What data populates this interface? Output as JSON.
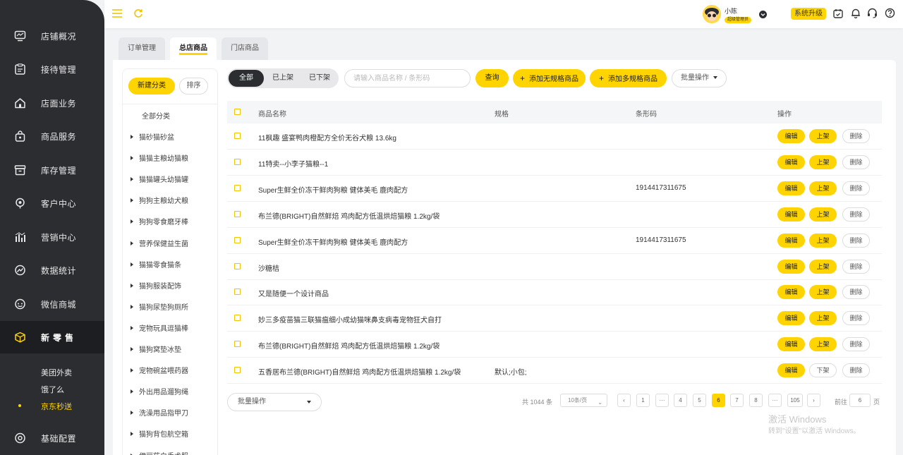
{
  "sidebar": {
    "items": [
      {
        "label": "店铺概况",
        "icon": "monitor-icon"
      },
      {
        "label": "接待管理",
        "icon": "clipboard-icon"
      },
      {
        "label": "店面业务",
        "icon": "home-icon"
      },
      {
        "label": "商品服务",
        "icon": "bag-icon"
      },
      {
        "label": "库存管理",
        "icon": "box-icon"
      },
      {
        "label": "客户中心",
        "icon": "location-icon"
      },
      {
        "label": "营销中心",
        "icon": "chart-bar-icon"
      },
      {
        "label": "数据统计",
        "icon": "trend-icon"
      },
      {
        "label": "微信商城",
        "icon": "wechat-icon"
      },
      {
        "label": "新零售",
        "icon": "cube-icon"
      },
      {
        "label": "基础配置",
        "icon": "settings-icon"
      }
    ],
    "sub_items": [
      "美团外卖",
      "饿了么",
      "京东秒送"
    ]
  },
  "topbar": {
    "user_name": "小陈",
    "user_role": "超级管理员",
    "upgrade_label": "系统升级"
  },
  "tabs": [
    "订单管理",
    "总店商品",
    "门店商品"
  ],
  "category": {
    "new_label": "新建分类",
    "sort_label": "排序",
    "all_label": "全部分类",
    "items": [
      "猫砂猫砂盆",
      "猫猫主粮幼猫粮",
      "猫猫罐头幼猫罐",
      "狗狗主粮幼犬粮",
      "狗狗零食磨牙棒",
      "营养保健益生菌",
      "猫猫零食猫条",
      "猫狗服装配饰",
      "猫狗尿垫狗厕所",
      "宠物玩具逗猫棒",
      "猫狗窝垫冰垫",
      "宠物碗盆喂药器",
      "外出用品遛狗绳",
      "洗澡用品指甲刀",
      "猫狗背包航空箱",
      "伊丽莎白手术服"
    ]
  },
  "filters": {
    "segments": [
      "全部",
      "已上架",
      "已下架"
    ],
    "search_placeholder": "请输入商品名称 / 条形码",
    "query_label": "查询",
    "add_no_spec_label": "添加无规格商品",
    "add_multi_spec_label": "添加多规格商品",
    "batch_label": "批量操作"
  },
  "table": {
    "headers": {
      "name": "商品名称",
      "spec": "规格",
      "barcode": "条形码",
      "ops": "操作"
    },
    "edit_label": "编辑",
    "delete_label": "删除",
    "rows": [
      {
        "name": "11枫趣 盛宴鸭肉橙配方全价无谷犬粮 13.6kg",
        "spec": "",
        "barcode": "",
        "status": "上架"
      },
      {
        "name": "11特卖--小李子猫粮--1",
        "spec": "",
        "barcode": "",
        "status": "上架"
      },
      {
        "name": "Super生鲜全价冻干鲜肉狗粮 健体美毛 鹿肉配方",
        "spec": "",
        "barcode": "1914417311675",
        "status": "上架"
      },
      {
        "name": "布兰德(BRIGHT)自然鲜焙 鸡肉配方低温烘焙猫粮 1.2kg/袋",
        "spec": "",
        "barcode": "",
        "status": "上架"
      },
      {
        "name": "Super生鲜全价冻干鲜肉狗粮 健体美毛 鹿肉配方",
        "spec": "",
        "barcode": "1914417311675",
        "status": "上架"
      },
      {
        "name": "沙糖桔",
        "spec": "",
        "barcode": "",
        "status": "上架"
      },
      {
        "name": "又是随便一个设计商品",
        "spec": "",
        "barcode": "",
        "status": "上架"
      },
      {
        "name": "妙三多疫苗猫三联猫瘟细小成幼猫咪鼻支病毒宠物狂犬自打",
        "spec": "",
        "barcode": "",
        "status": "上架"
      },
      {
        "name": "布兰德(BRIGHT)自然鲜焙 鸡肉配方低温烘焙猫粮 1.2kg/袋",
        "spec": "",
        "barcode": "",
        "status": "上架"
      },
      {
        "name": "五香居布兰德(BRIGHT)自然鲜焙 鸡肉配方低温烘焙猫粮 1.2kg/袋",
        "spec": "默认;小包;",
        "barcode": "",
        "status": "下架"
      }
    ]
  },
  "pagination": {
    "batch_label": "批量操作",
    "total": "共 1044 条",
    "page_size": "10条/页",
    "pages": [
      "1",
      "···",
      "4",
      "5",
      "6",
      "7",
      "8",
      "···",
      "105"
    ],
    "current": "6",
    "goto_prefix": "前往",
    "goto_value": "6",
    "goto_suffix": "页"
  },
  "watermark": {
    "line1": "激活 Windows",
    "line2": "转到\"设置\"以激活 Windows。"
  },
  "colors": {
    "accent": "#ffd400",
    "sidebar_bg": "#2b2d31"
  }
}
